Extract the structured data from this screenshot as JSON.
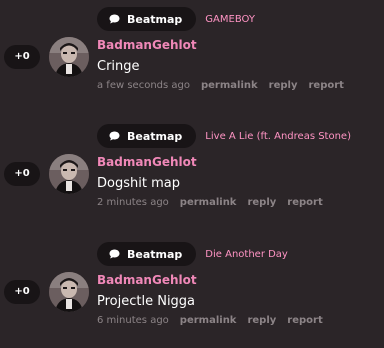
{
  "colors": {
    "background": "#2b2528",
    "pill": "#181416",
    "username": "#f088b8",
    "map_title": "#ff94c4",
    "meta": "#8c8487",
    "text": "#ffffff"
  },
  "icons": {
    "beatmap_pill": "speech-bubble-icon"
  },
  "comments": [
    {
      "pill_label": "Beatmap",
      "map_title": "GAMEBOY",
      "votes": "+0",
      "username": "BadmanGehlot",
      "message": "Cringe",
      "time": "a few seconds ago",
      "actions": [
        "permalink",
        "reply",
        "report"
      ]
    },
    {
      "pill_label": "Beatmap",
      "map_title": "Live A Lie (ft. Andreas Stone)",
      "votes": "+0",
      "username": "BadmanGehlot",
      "message": "Dogshit map",
      "time": "2 minutes ago",
      "actions": [
        "permalink",
        "reply",
        "report"
      ]
    },
    {
      "pill_label": "Beatmap",
      "map_title": "Die Another Day",
      "votes": "+0",
      "username": "BadmanGehlot",
      "message": "Projectle Nigga",
      "time": "6 minutes ago",
      "actions": [
        "permalink",
        "reply",
        "report"
      ]
    }
  ]
}
